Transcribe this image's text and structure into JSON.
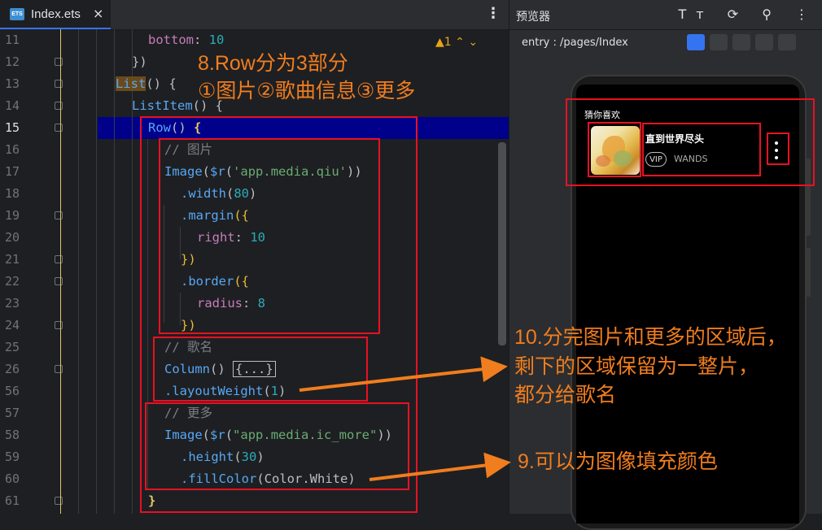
{
  "editor": {
    "tab_name": "Index.ets",
    "tab_close": "×",
    "tab_menu": "⋮",
    "warning": "▲1",
    "lines": [
      "11",
      "12",
      "13",
      "14",
      "15",
      "16",
      "17",
      "18",
      "19",
      "20",
      "21",
      "22",
      "23",
      "24",
      "25",
      "26",
      "56",
      "57",
      "58",
      "59",
      "60",
      "61"
    ],
    "code": {
      "l11_a": "bottom",
      "l11_b": ": ",
      "l11_c": "10",
      "l12": "})",
      "l13_a": "List",
      "l13_b": "() {",
      "l14_a": "ListItem",
      "l14_b": "() {",
      "l15_a": "Row",
      "l15_b": "() ",
      "l15_c": "{",
      "l16": "// 图片",
      "l17_a": "Image",
      "l17_b": "(",
      "l17_c": "$r",
      "l17_d": "(",
      "l17_e": "'app.media.qiu'",
      "l17_f": "))",
      "l18_a": ".width",
      "l18_b": "(",
      "l18_c": "80",
      "l18_d": ")",
      "l19_a": ".margin",
      "l19_b": "({",
      "l20_a": "right",
      "l20_b": ": ",
      "l20_c": "10",
      "l21": "})",
      "l22_a": ".border",
      "l22_b": "({",
      "l23_a": "radius",
      "l23_b": ": ",
      "l23_c": "8",
      "l24": "})",
      "l25": "// 歌名",
      "l26_a": "Column",
      "l26_b": "() ",
      "l26_c": "{...}",
      "l56_a": ".layoutWeight",
      "l56_b": "(",
      "l56_c": "1",
      "l56_d": ")",
      "l57": "// 更多",
      "l58_a": "Image",
      "l58_b": "(",
      "l58_c": "$r",
      "l58_d": "(",
      "l58_e": "\"app.media.ic_more\"",
      "l58_f": "))",
      "l59_a": ".height",
      "l59_b": "(",
      "l59_c": "30",
      "l59_d": ")",
      "l60_a": ".fillColor",
      "l60_b": "(",
      "l60_c": "Color.White",
      "l60_d": ")",
      "l61": "}"
    }
  },
  "annotations": {
    "a8_title": "8.Row分为3部分",
    "a8_parts": "①图片②歌曲信息③更多",
    "a10_l1": "10.分完图片和更多的区域后，",
    "a10_l2": "剩下的区域保留为一整片，",
    "a10_l3": "都分给歌名",
    "a9": "9.可以为图像填充颜色"
  },
  "preview": {
    "title": "预览器",
    "route": "entry : /pages/Index",
    "section_title": "猜你喜欢",
    "song_name": "直到世界尽头",
    "vip_badge": "VIP",
    "artist": "WANDS"
  },
  "colors": {
    "accent_red": "#e81123",
    "annotation_orange": "#f07d1e",
    "highlight_line": "#00008b"
  }
}
